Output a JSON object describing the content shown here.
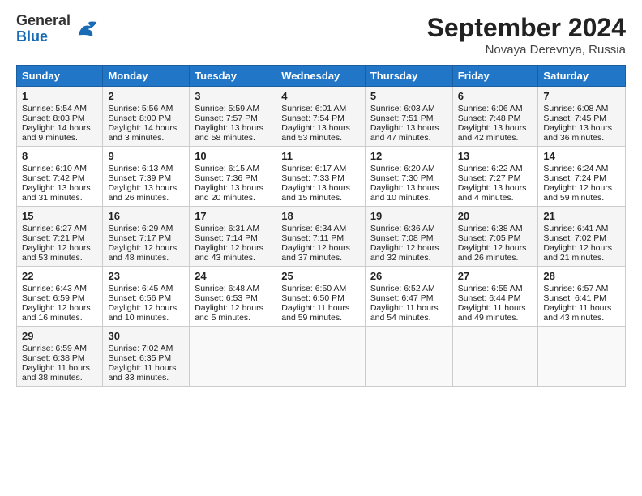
{
  "header": {
    "logo_general": "General",
    "logo_blue": "Blue",
    "month_title": "September 2024",
    "location": "Novaya Derevnya, Russia"
  },
  "weekdays": [
    "Sunday",
    "Monday",
    "Tuesday",
    "Wednesday",
    "Thursday",
    "Friday",
    "Saturday"
  ],
  "weeks": [
    [
      {
        "day": "1",
        "sunrise": "5:54 AM",
        "sunset": "8:03 PM",
        "daylight": "14 hours and 9 minutes."
      },
      {
        "day": "2",
        "sunrise": "5:56 AM",
        "sunset": "8:00 PM",
        "daylight": "14 hours and 3 minutes."
      },
      {
        "day": "3",
        "sunrise": "5:59 AM",
        "sunset": "7:57 PM",
        "daylight": "13 hours and 58 minutes."
      },
      {
        "day": "4",
        "sunrise": "6:01 AM",
        "sunset": "7:54 PM",
        "daylight": "13 hours and 53 minutes."
      },
      {
        "day": "5",
        "sunrise": "6:03 AM",
        "sunset": "7:51 PM",
        "daylight": "13 hours and 47 minutes."
      },
      {
        "day": "6",
        "sunrise": "6:06 AM",
        "sunset": "7:48 PM",
        "daylight": "13 hours and 42 minutes."
      },
      {
        "day": "7",
        "sunrise": "6:08 AM",
        "sunset": "7:45 PM",
        "daylight": "13 hours and 36 minutes."
      }
    ],
    [
      {
        "day": "8",
        "sunrise": "6:10 AM",
        "sunset": "7:42 PM",
        "daylight": "13 hours and 31 minutes."
      },
      {
        "day": "9",
        "sunrise": "6:13 AM",
        "sunset": "7:39 PM",
        "daylight": "13 hours and 26 minutes."
      },
      {
        "day": "10",
        "sunrise": "6:15 AM",
        "sunset": "7:36 PM",
        "daylight": "13 hours and 20 minutes."
      },
      {
        "day": "11",
        "sunrise": "6:17 AM",
        "sunset": "7:33 PM",
        "daylight": "13 hours and 15 minutes."
      },
      {
        "day": "12",
        "sunrise": "6:20 AM",
        "sunset": "7:30 PM",
        "daylight": "13 hours and 10 minutes."
      },
      {
        "day": "13",
        "sunrise": "6:22 AM",
        "sunset": "7:27 PM",
        "daylight": "13 hours and 4 minutes."
      },
      {
        "day": "14",
        "sunrise": "6:24 AM",
        "sunset": "7:24 PM",
        "daylight": "12 hours and 59 minutes."
      }
    ],
    [
      {
        "day": "15",
        "sunrise": "6:27 AM",
        "sunset": "7:21 PM",
        "daylight": "12 hours and 53 minutes."
      },
      {
        "day": "16",
        "sunrise": "6:29 AM",
        "sunset": "7:17 PM",
        "daylight": "12 hours and 48 minutes."
      },
      {
        "day": "17",
        "sunrise": "6:31 AM",
        "sunset": "7:14 PM",
        "daylight": "12 hours and 43 minutes."
      },
      {
        "day": "18",
        "sunrise": "6:34 AM",
        "sunset": "7:11 PM",
        "daylight": "12 hours and 37 minutes."
      },
      {
        "day": "19",
        "sunrise": "6:36 AM",
        "sunset": "7:08 PM",
        "daylight": "12 hours and 32 minutes."
      },
      {
        "day": "20",
        "sunrise": "6:38 AM",
        "sunset": "7:05 PM",
        "daylight": "12 hours and 26 minutes."
      },
      {
        "day": "21",
        "sunrise": "6:41 AM",
        "sunset": "7:02 PM",
        "daylight": "12 hours and 21 minutes."
      }
    ],
    [
      {
        "day": "22",
        "sunrise": "6:43 AM",
        "sunset": "6:59 PM",
        "daylight": "12 hours and 16 minutes."
      },
      {
        "day": "23",
        "sunrise": "6:45 AM",
        "sunset": "6:56 PM",
        "daylight": "12 hours and 10 minutes."
      },
      {
        "day": "24",
        "sunrise": "6:48 AM",
        "sunset": "6:53 PM",
        "daylight": "12 hours and 5 minutes."
      },
      {
        "day": "25",
        "sunrise": "6:50 AM",
        "sunset": "6:50 PM",
        "daylight": "11 hours and 59 minutes."
      },
      {
        "day": "26",
        "sunrise": "6:52 AM",
        "sunset": "6:47 PM",
        "daylight": "11 hours and 54 minutes."
      },
      {
        "day": "27",
        "sunrise": "6:55 AM",
        "sunset": "6:44 PM",
        "daylight": "11 hours and 49 minutes."
      },
      {
        "day": "28",
        "sunrise": "6:57 AM",
        "sunset": "6:41 PM",
        "daylight": "11 hours and 43 minutes."
      }
    ],
    [
      {
        "day": "29",
        "sunrise": "6:59 AM",
        "sunset": "6:38 PM",
        "daylight": "11 hours and 38 minutes."
      },
      {
        "day": "30",
        "sunrise": "7:02 AM",
        "sunset": "6:35 PM",
        "daylight": "11 hours and 33 minutes."
      },
      null,
      null,
      null,
      null,
      null
    ]
  ]
}
